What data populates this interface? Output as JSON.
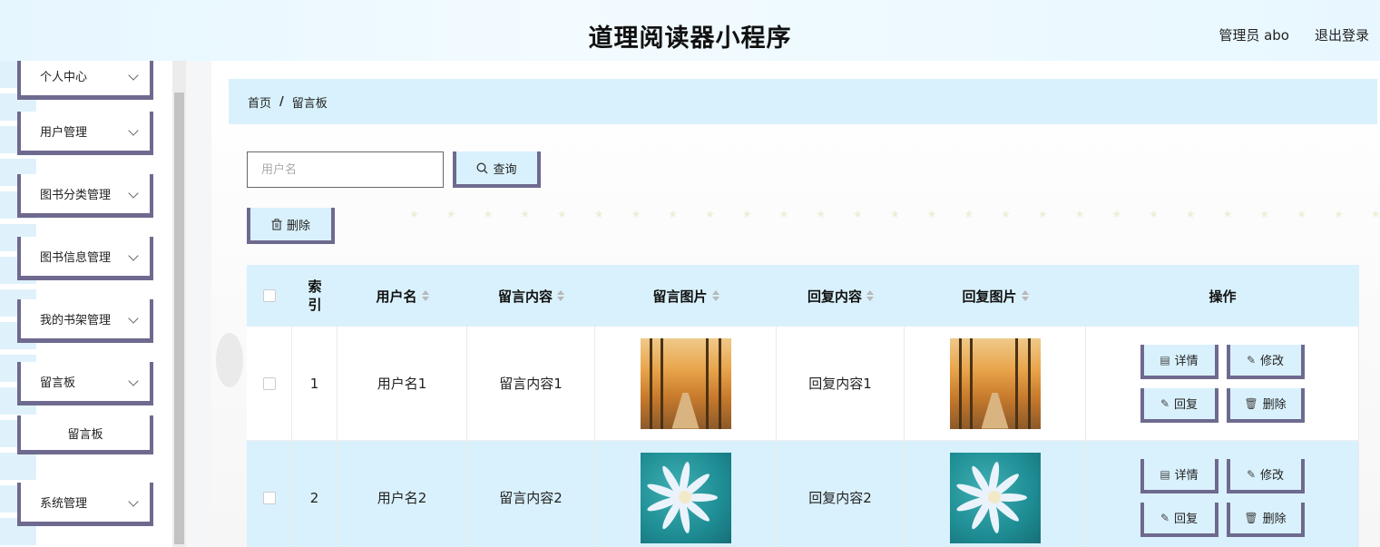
{
  "header": {
    "title": "道理阅读器小程序",
    "user": "管理员 abo",
    "logout": "退出登录"
  },
  "sidebar": {
    "items": [
      {
        "label": "个人中心"
      },
      {
        "label": "用户管理"
      },
      {
        "label": "图书分类管理"
      },
      {
        "label": "图书信息管理"
      },
      {
        "label": "我的书架管理"
      },
      {
        "label": "留言板"
      },
      {
        "label": "系统管理"
      }
    ],
    "submenu": {
      "label": "留言板"
    }
  },
  "breadcrumb": {
    "home": "首页",
    "separator": "/",
    "current": "留言板"
  },
  "search": {
    "placeholder": "用户名",
    "query_label": "查询"
  },
  "toolbar": {
    "delete_label": "删除"
  },
  "table": {
    "headers": {
      "index": "索引",
      "username": "用户名",
      "content": "留言内容",
      "image": "留言图片",
      "reply": "回复内容",
      "reply_image": "回复图片",
      "actions": "操作"
    },
    "rows": [
      {
        "index": "1",
        "username": "用户名1",
        "content": "留言内容1",
        "reply": "回复内容1"
      },
      {
        "index": "2",
        "username": "用户名2",
        "content": "留言内容2",
        "reply": "回复内容2"
      }
    ],
    "actions": {
      "detail": "详情",
      "edit": "修改",
      "reply": "回复",
      "delete": "删除"
    }
  },
  "colors": {
    "accent_border": "#6e6a8f",
    "light_blue": "#d9f1fc"
  }
}
